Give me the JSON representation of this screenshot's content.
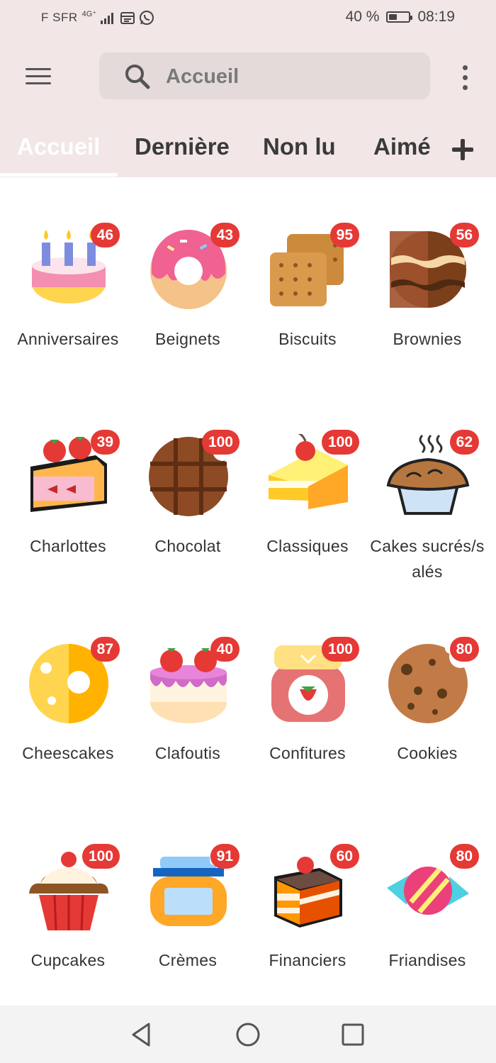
{
  "status_bar": {
    "carrier": "F SFR",
    "network": "4G⁺",
    "battery_text": "40 %",
    "battery_level": 0.4,
    "time": "08:19"
  },
  "header": {
    "search_placeholder": "Accueil",
    "icons": {
      "menu": "hamburger-menu-icon",
      "search": "search-icon",
      "more": "more-vert-icon",
      "add": "plus-icon"
    }
  },
  "tabs": [
    {
      "label": "Accueil",
      "active": true
    },
    {
      "label": "Dernière",
      "active": false
    },
    {
      "label": "Non lu",
      "active": false
    },
    {
      "label": "Aimé",
      "active": false
    }
  ],
  "categories": [
    {
      "label": "Anniversaires",
      "count": "46",
      "icon": "birthday-cake-icon"
    },
    {
      "label": "Beignets",
      "count": "43",
      "icon": "donut-icon"
    },
    {
      "label": "Biscuits",
      "count": "95",
      "icon": "biscuit-icon"
    },
    {
      "label": "Brownies",
      "count": "56",
      "icon": "brownie-icon"
    },
    {
      "label": "Charlottes",
      "count": "39",
      "icon": "strawberry-cake-slice-icon"
    },
    {
      "label": "Chocolat",
      "count": "100",
      "icon": "chocolate-bar-icon"
    },
    {
      "label": "Classiques",
      "count": "100",
      "icon": "cake-slice-cherry-icon"
    },
    {
      "label": "Cakes sucrés/salés",
      "count": "62",
      "icon": "pie-icon"
    },
    {
      "label": "Cheescakes",
      "count": "87",
      "icon": "cheesecake-icon"
    },
    {
      "label": "Clafoutis",
      "count": "40",
      "icon": "strawberry-cake-icon"
    },
    {
      "label": "Confitures",
      "count": "100",
      "icon": "jam-jar-icon"
    },
    {
      "label": "Cookies",
      "count": "80",
      "icon": "cookie-icon"
    },
    {
      "label": "Cupcakes",
      "count": "100",
      "icon": "cupcake-icon"
    },
    {
      "label": "Crèmes",
      "count": "91",
      "icon": "cream-jar-icon"
    },
    {
      "label": "Financiers",
      "count": "60",
      "icon": "layer-cake-icon"
    },
    {
      "label": "Friandises",
      "count": "80",
      "icon": "candy-icon"
    }
  ],
  "nav_bar": {
    "back": "back-triangle-icon",
    "home": "home-circle-icon",
    "recents": "recents-square-icon"
  },
  "colors": {
    "app_bar": "#f2e6e6",
    "badge": "#e53935",
    "active_tab": "#ffffff"
  }
}
